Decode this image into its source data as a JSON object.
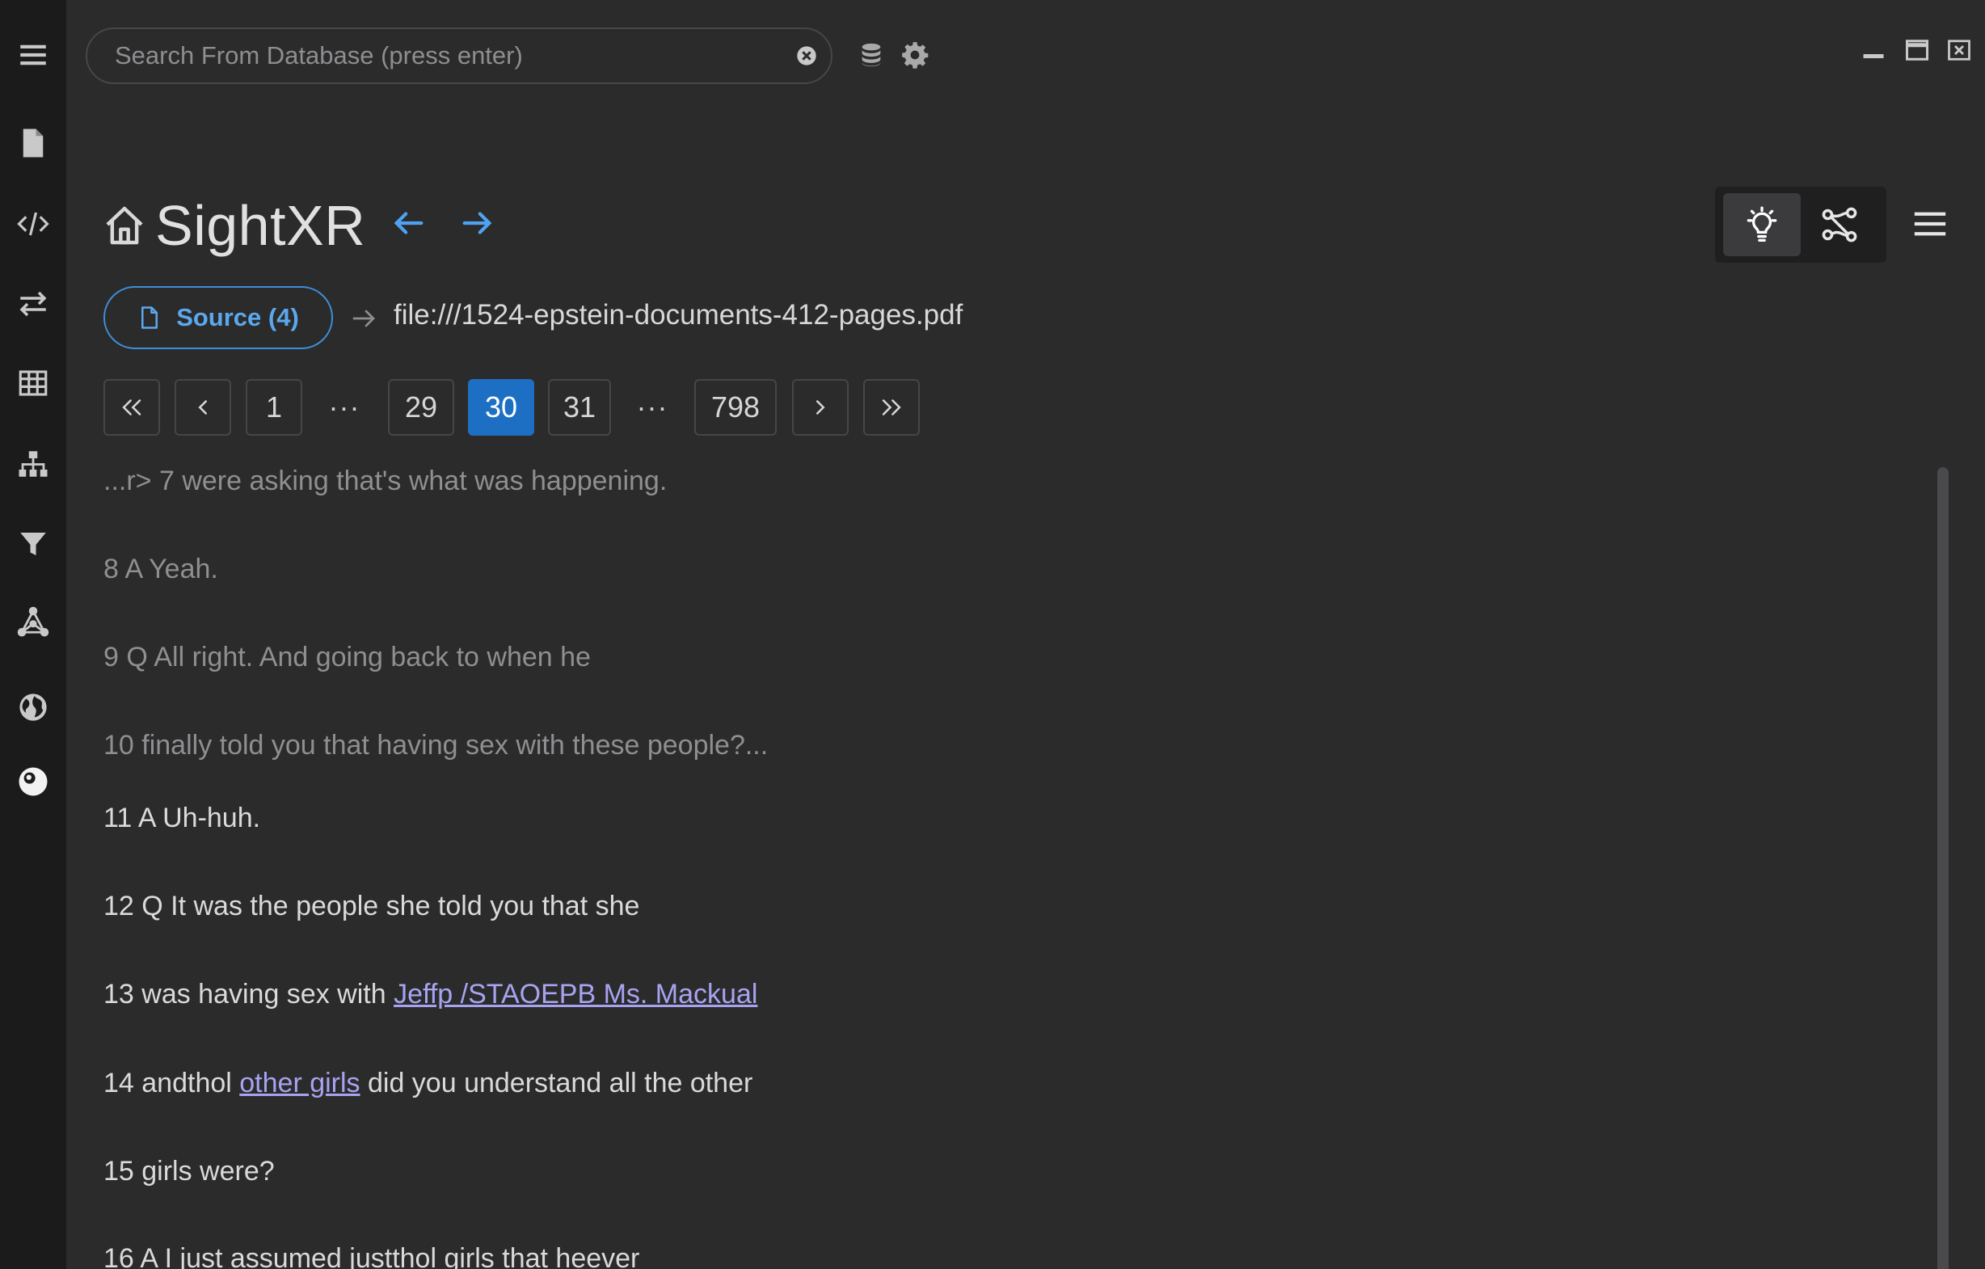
{
  "search": {
    "placeholder": "Search From Database (press enter)",
    "value": ""
  },
  "sidebar": {
    "items": [
      {
        "name": "menu-icon"
      },
      {
        "name": "file-icon"
      },
      {
        "name": "code-icon"
      },
      {
        "name": "swap-icon"
      },
      {
        "name": "table-icon"
      },
      {
        "name": "hierarchy-icon"
      },
      {
        "name": "filter-icon"
      },
      {
        "name": "network-icon"
      },
      {
        "name": "globe-icon"
      },
      {
        "name": "mind-icon"
      }
    ]
  },
  "header": {
    "title": "SightXR"
  },
  "source": {
    "label": "Source (4)",
    "path": "file:///1524-epstein-documents-412-pages.pdf"
  },
  "pagination": {
    "first": "«",
    "prev": "‹",
    "next": "›",
    "last": "»",
    "pages": [
      "1",
      "29",
      "30",
      "31",
      "798"
    ],
    "ellipsis": "···",
    "current": "30"
  },
  "content": {
    "lines": [
      {
        "text": "...r> 7 were asking that's what was happening."
      },
      {
        "text": "8 A Yeah."
      },
      {
        "text": "9 Q All right. And going back to when he"
      },
      {
        "text": "10 finally told you that having sex with these people?..."
      },
      {
        "text": "11 A Uh-huh."
      },
      {
        "text": "12 Q It was the people she told you that she"
      },
      {
        "prefix": "13 was having sex with ",
        "link": "Jeffp /STAOEPB Ms. Mackual",
        "suffix": ""
      },
      {
        "prefix": "14 andthol ",
        "link": "other girls",
        "suffix": " did you understand all the other"
      },
      {
        "text": "15 girls were?"
      },
      {
        "text": "16 A I just assumed justthol girls that heever"
      }
    ]
  },
  "colors": {
    "background": "#2b2b2c",
    "sidebar": "#1b1b1c",
    "accent": "#1d6fc4",
    "link": "#a8a3f0",
    "arrow": "#4ea3f0"
  }
}
